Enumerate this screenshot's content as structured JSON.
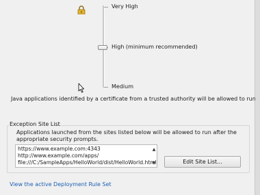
{
  "security_levels": {
    "very_high": "Very High",
    "high": "High (minimum recommended)",
    "medium": "Medium",
    "selected": "High (minimum recommended)"
  },
  "description": "Java applications identified by a certificate from a trusted authority will be allowed to run.",
  "exception_site_list": {
    "title": "Exception Site List",
    "description": "Applications launched from the sites listed below will be allowed to run after the appropriate security prompts.",
    "sites": [
      "https://www.example.com:4343",
      "http://www.example.com/apps/",
      "file:///C:/SampleApps/HelloWorld/dist/HelloWorld.html"
    ],
    "edit_button_label": "Edit Site List..."
  },
  "deployment_rule_link": "View the active Deployment Rule Set",
  "icons": {
    "lock": "lock-icon",
    "cursor": "mouse-pointer-icon",
    "scroll_up": "scroll-up-arrow-icon",
    "scroll_down": "scroll-down-arrow-icon"
  },
  "colors": {
    "background": "#f0f0f0",
    "link": "#1a5fb4",
    "lock": "#d9a520"
  }
}
